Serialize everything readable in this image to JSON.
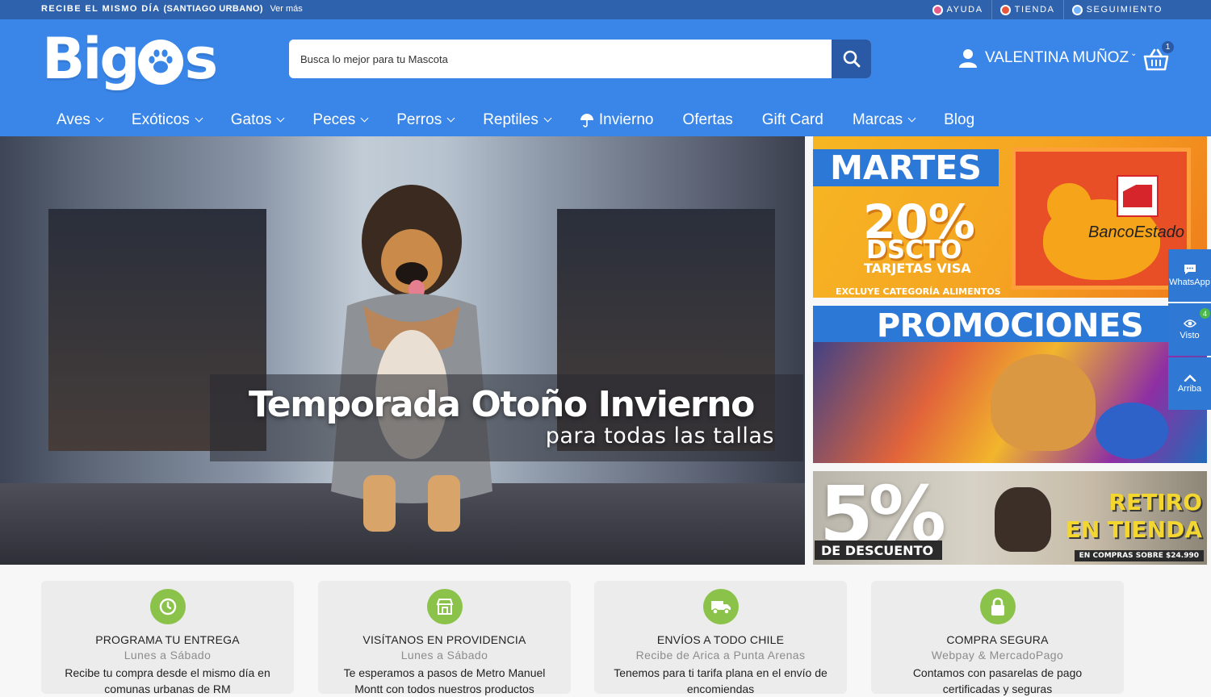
{
  "topbar": {
    "promo_bold": "RECIBE EL MISMO DÍA",
    "promo_paren": "(SANTIAGO URBANO)",
    "promo_more": "Ver más",
    "links": [
      {
        "label": "AYUDA",
        "icon": "heart-icon",
        "color": "#e85a8a"
      },
      {
        "label": "TIENDA",
        "icon": "store-icon",
        "color": "#e8553b"
      },
      {
        "label": "SEGUIMIENTO",
        "icon": "tracking-icon",
        "color": "#6fb2ff"
      }
    ]
  },
  "header": {
    "logo_text_left": "Big",
    "logo_text_right": "s",
    "search_placeholder": "Busca lo mejor para tu Mascota",
    "user_name": "VALENTINA MUÑOZ",
    "cart_count": "1"
  },
  "nav": [
    {
      "label": "Aves",
      "dropdown": true,
      "icon": null
    },
    {
      "label": "Exóticos",
      "dropdown": true,
      "icon": null
    },
    {
      "label": "Gatos",
      "dropdown": true,
      "icon": null
    },
    {
      "label": "Peces",
      "dropdown": true,
      "icon": null
    },
    {
      "label": "Perros",
      "dropdown": true,
      "icon": null
    },
    {
      "label": "Reptiles",
      "dropdown": true,
      "icon": null
    },
    {
      "label": "Invierno",
      "dropdown": false,
      "icon": "umbrella-icon"
    },
    {
      "label": "Ofertas",
      "dropdown": false,
      "icon": null
    },
    {
      "label": "Gift Card",
      "dropdown": false,
      "icon": null
    },
    {
      "label": "Marcas",
      "dropdown": true,
      "icon": null
    },
    {
      "label": "Blog",
      "dropdown": false,
      "icon": null
    }
  ],
  "hero": {
    "title": "Temporada Otoño Invierno",
    "subtitle": "para todas las tallas"
  },
  "banners": {
    "martes": {
      "label": "MARTES",
      "percent": "20%",
      "dscto": "DSCTO",
      "cards": "TARJETAS VISA",
      "note": "EXCLUYE CATEGORÍA ALIMENTOS",
      "bank": "BancoEstado"
    },
    "promociones": {
      "title": "PROMOCIONES"
    },
    "retiro": {
      "percent": "5%",
      "desc": "DE DESCUENTO",
      "line1": "RETIRO",
      "line2": "EN TIENDA",
      "note": "EN COMPRAS SOBRE $24.990"
    }
  },
  "floaters": [
    {
      "label": "WhatsApp",
      "icon": "chat-icon",
      "badge": null
    },
    {
      "label": "Visto",
      "icon": "eye-icon",
      "badge": "4"
    },
    {
      "label": "Arriba",
      "icon": "arrow-up-icon",
      "badge": null
    }
  ],
  "features": [
    {
      "title": "PROGRAMA TU ENTREGA",
      "sub": "Lunes a Sábado",
      "desc": "Recibe tu compra desde el mismo día en comunas urbanas de RM",
      "icon": "clock-icon"
    },
    {
      "title": "VISÍTANOS EN PROVIDENCIA",
      "sub": "Lunes a Sábado",
      "desc": "Te esperamos a pasos de Metro Manuel Montt con todos nuestros productos",
      "icon": "store-icon"
    },
    {
      "title": "ENVÍOS A TODO CHILE",
      "sub": "Recibe de Arica a Punta Arenas",
      "desc": "Tenemos para ti tarifa plana en el envío de encomiendas",
      "icon": "truck-icon"
    },
    {
      "title": "COMPRA SEGURA",
      "sub": "Webpay & MercadoPago",
      "desc": "Contamos con pasarelas de pago certificadas y seguras",
      "icon": "lock-icon"
    }
  ],
  "colors": {
    "header_blue": "#3a86e8",
    "topbar_blue": "#2f62ad",
    "accent_green": "#8bc34a",
    "floater_blue": "#2f79d5"
  }
}
